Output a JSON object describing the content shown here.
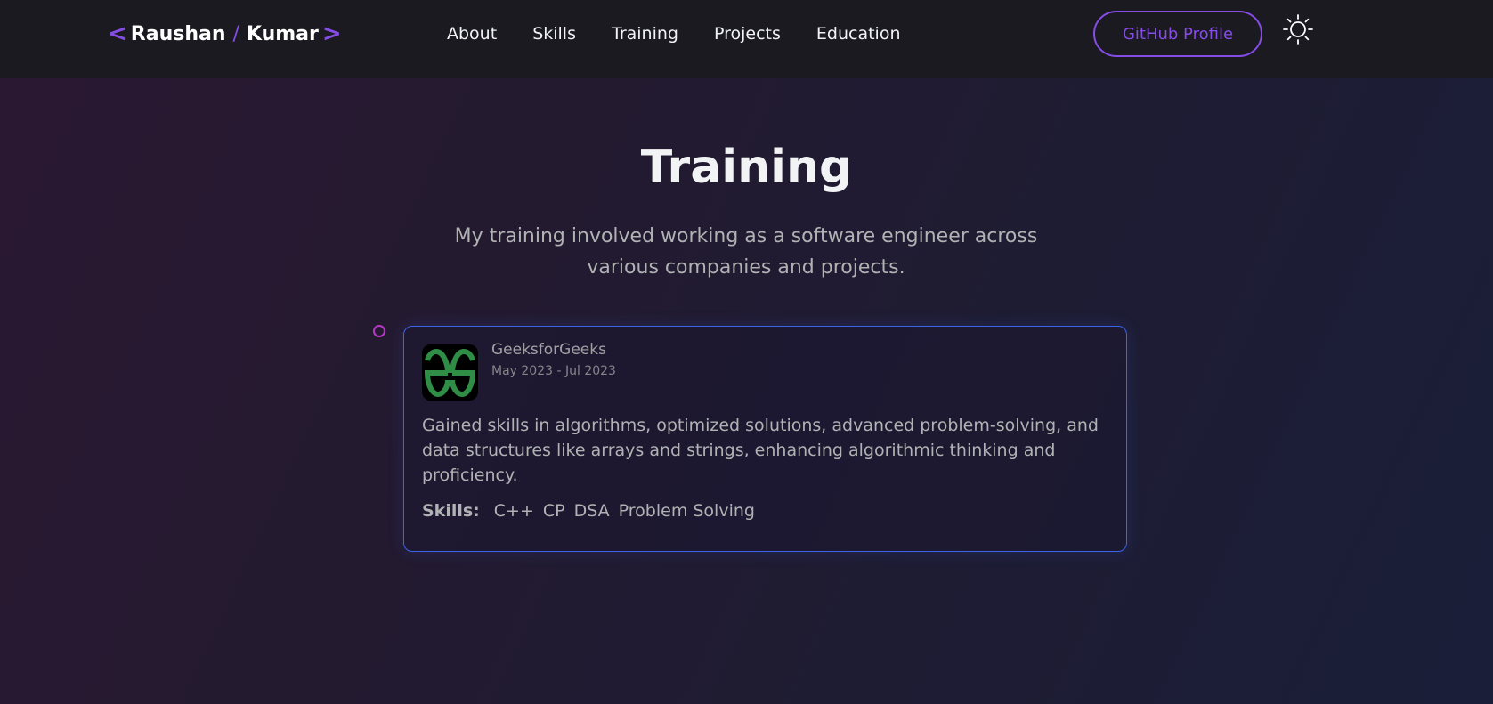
{
  "nav": {
    "logo_first": "Raushan",
    "logo_slash": "/",
    "logo_last": "Kumar",
    "links": [
      "About",
      "Skills",
      "Training",
      "Projects",
      "Education"
    ],
    "github_label": "GitHub Profile",
    "theme_icon": "sun-icon"
  },
  "section": {
    "title": "Training",
    "subtitle": "My training involved working as a software engineer across various companies and projects."
  },
  "training": [
    {
      "company": "GeeksforGeeks",
      "date": "May 2023 - Jul 2023",
      "logo_icon": "geeksforgeeks-logo",
      "description": "Gained skills in algorithms, optimized solutions, advanced problem-solving, and data structures like arrays and strings, enhancing algorithmic thinking and proficiency.",
      "skills_label": "Skills:",
      "skills": [
        "C++",
        "CP",
        "DSA",
        "Problem Solving"
      ]
    }
  ],
  "colors": {
    "accent": "#854ce6",
    "card_border": "#3b64e6",
    "timeline_dot": "#b638c6",
    "gfg_green": "#2f8d46"
  }
}
